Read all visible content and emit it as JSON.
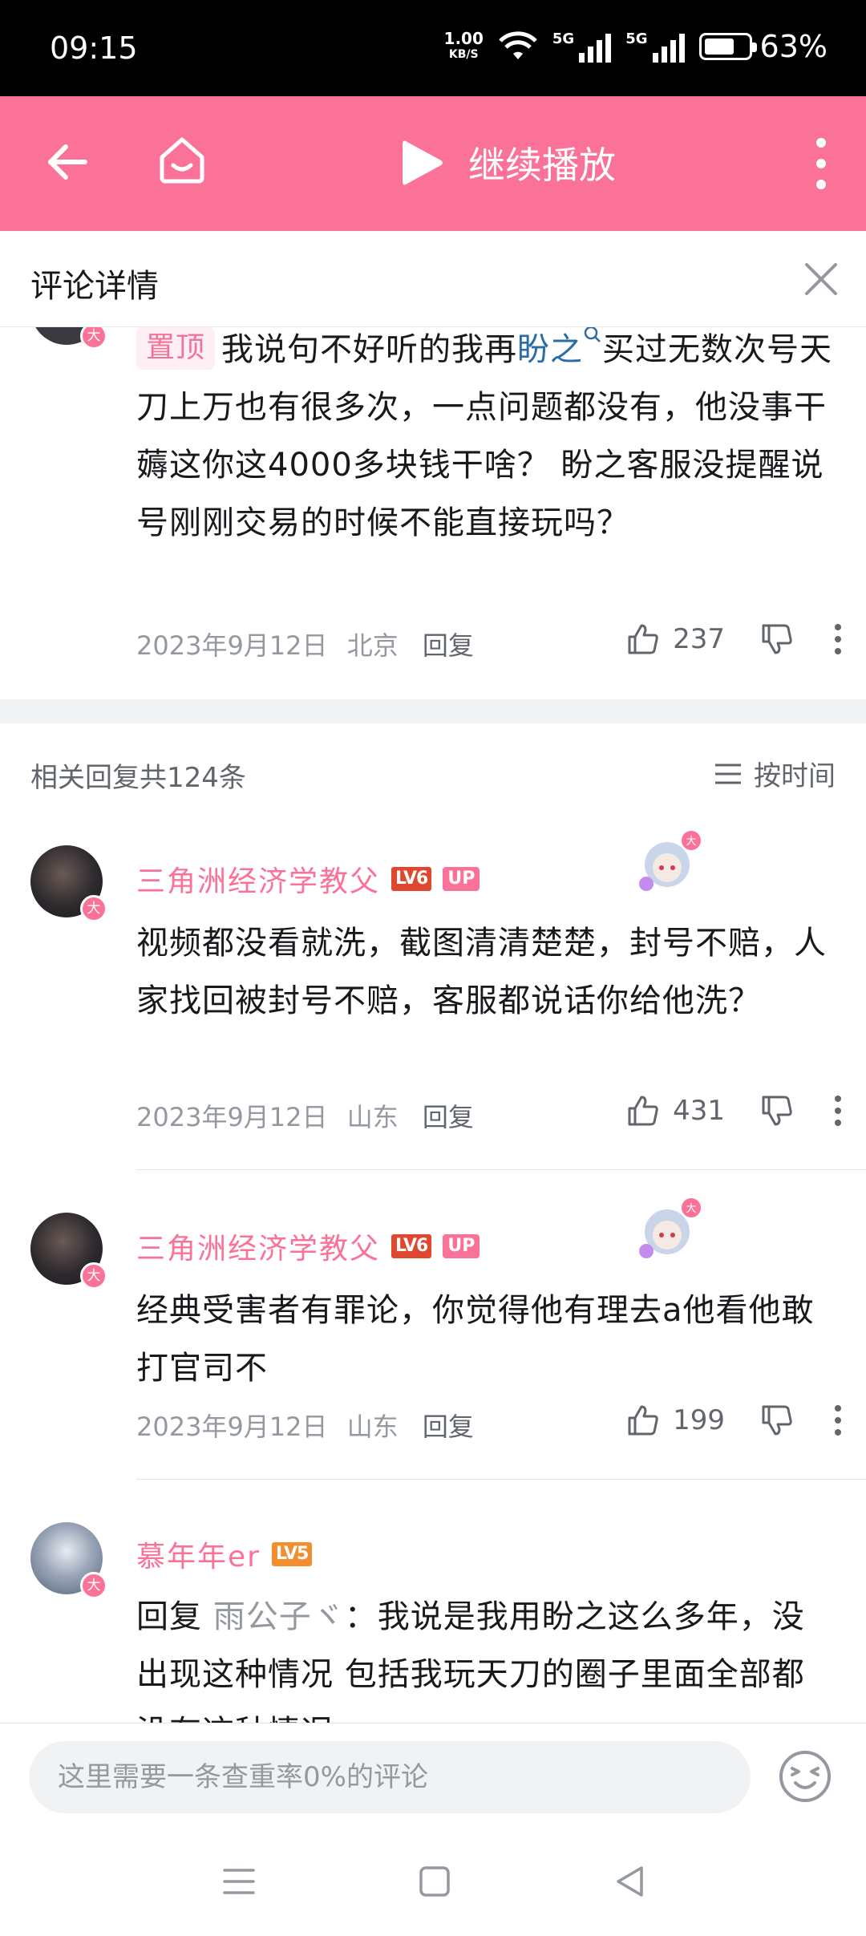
{
  "status_bar": {
    "time": "09:15",
    "net_speed_value": "1.00",
    "net_speed_unit": "KB/S",
    "signal1_label": "5G",
    "signal2_label": "5G",
    "battery_percent": "63%",
    "battery_level": 0.63
  },
  "topbar": {
    "continue_play_label": "继续播放",
    "accent_color": "#fb7299"
  },
  "header": {
    "title": "评论详情"
  },
  "main_comment": {
    "pin_label": "置顶",
    "text_before_link": "我说句不好听的我再",
    "link_text": "盼之",
    "text_after_link": "买过无数次号天刀上万也有很多次，一点问题都没有，他没事干薅这你这4000多块钱干啥？ 盼之客服没提醒说号刚刚交易的时候不能直接玩吗？",
    "date": "2023年9月12日",
    "location": "北京",
    "reply_label": "回复",
    "likes": "237"
  },
  "replies_header": {
    "count_label": "相关回复共124条",
    "sort_label": "按时间"
  },
  "replies": [
    {
      "username": "三角洲经济学教父",
      "level": "LV6",
      "up_tag": "UP",
      "text": "视频都没看就洗，截图清清楚楚，封号不赔，人家找回被封号不赔，客服都说话你给他洗？",
      "date": "2023年9月12日",
      "location": "山东",
      "reply_label": "回复",
      "likes": "431"
    },
    {
      "username": "三角洲经济学教父",
      "level": "LV6",
      "up_tag": "UP",
      "text": "经典受害者有罪论，你觉得他有理去a他看他敢打官司不",
      "date": "2023年9月12日",
      "location": "山东",
      "reply_label": "回复",
      "likes": "199"
    },
    {
      "username": "慕年年er",
      "level": "LV5",
      "reply_prefix": "回复",
      "mention": "雨公子ヾ",
      "text": "：我说是我用盼之这么多年，没出现这种情况 包括我玩天刀的圈子里面全部都没有这种情况"
    }
  ],
  "input": {
    "placeholder": "这里需要一条查重率0%的评论"
  }
}
